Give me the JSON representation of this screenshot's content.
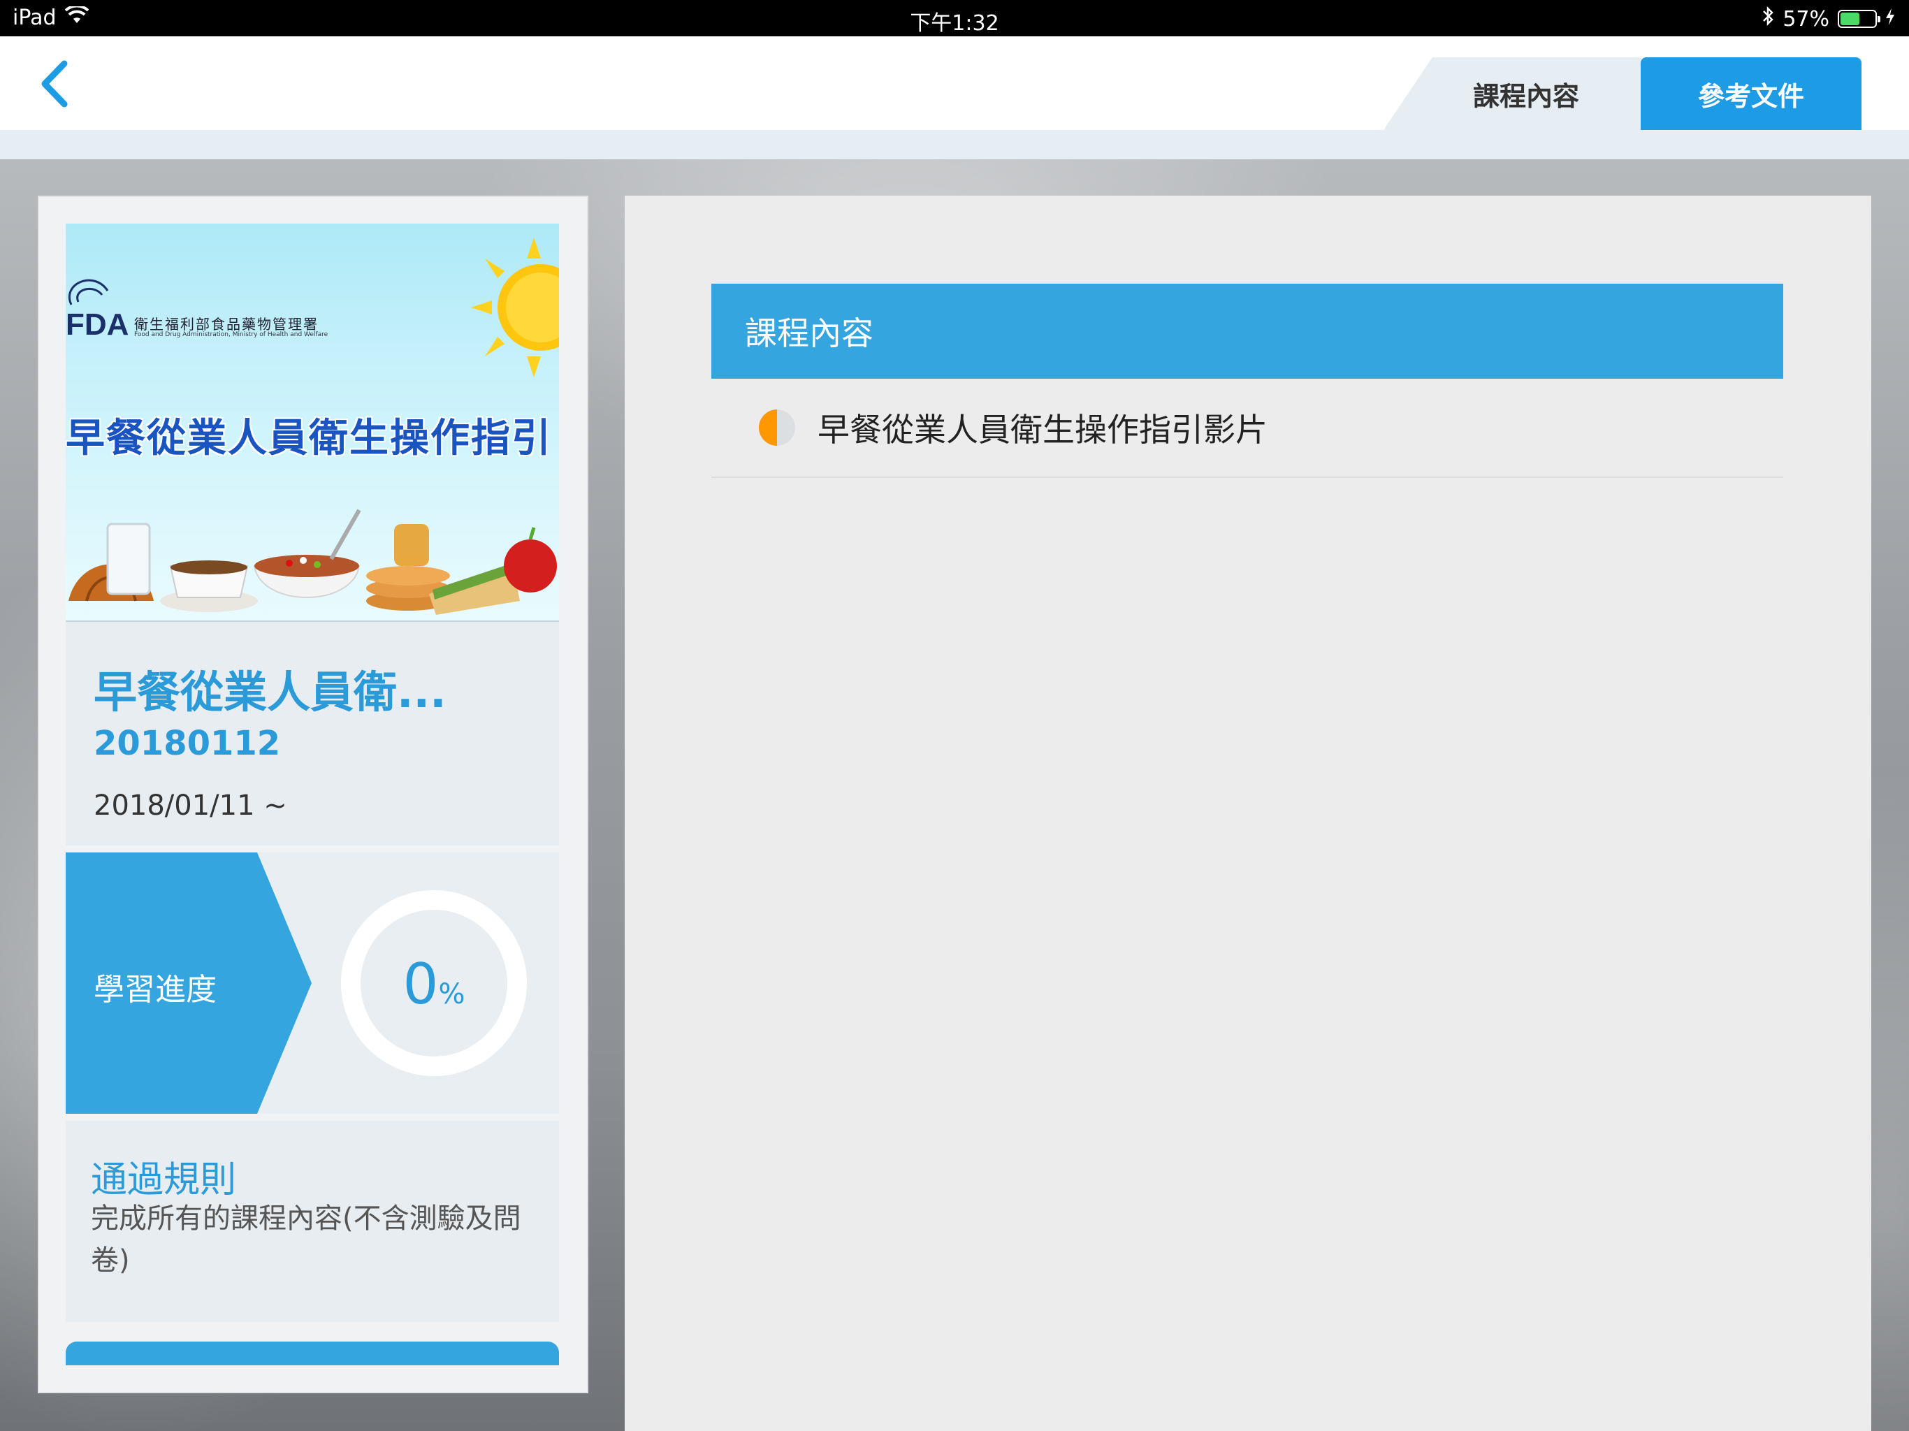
{
  "status_bar": {
    "device": "iPad",
    "time": "下午1:32",
    "battery": "57%",
    "battery_level": 0.57,
    "icons": [
      "wifi-icon",
      "bluetooth-icon",
      "battery-icon",
      "charging-icon"
    ]
  },
  "nav": {
    "back_icon": "chevron-left-icon",
    "tabs": [
      {
        "label": "課程內容",
        "active": false
      },
      {
        "label": "參考文件",
        "active": true
      }
    ]
  },
  "course": {
    "thumbnail": {
      "agency_logo": "FDA",
      "agency_name": "衛生福利部食品藥物管理署",
      "agency_name_en": "Food and Drug Administration, Ministry of Health and Welfare",
      "banner_title": "早餐從業人員衛生操作指引"
    },
    "title": "早餐從業人員衛...",
    "code": "20180112",
    "date": "2018/01/11 ~",
    "progress": {
      "label": "學習進度",
      "value": "0",
      "unit": "%",
      "fraction": 0
    },
    "rules": {
      "title": "通過規則",
      "text": "完成所有的課程內容(不含測驗及問卷)"
    }
  },
  "content": {
    "section_title": "課程內容",
    "items": [
      {
        "label": "早餐從業人員衛生操作指引影片",
        "status": "half-complete",
        "status_colors": [
          "#ff9800",
          "#dcdfe2"
        ]
      }
    ]
  },
  "colors": {
    "accent": "#34a5de",
    "tab_active": "#1e9be5",
    "status_orange": "#ff9800"
  }
}
